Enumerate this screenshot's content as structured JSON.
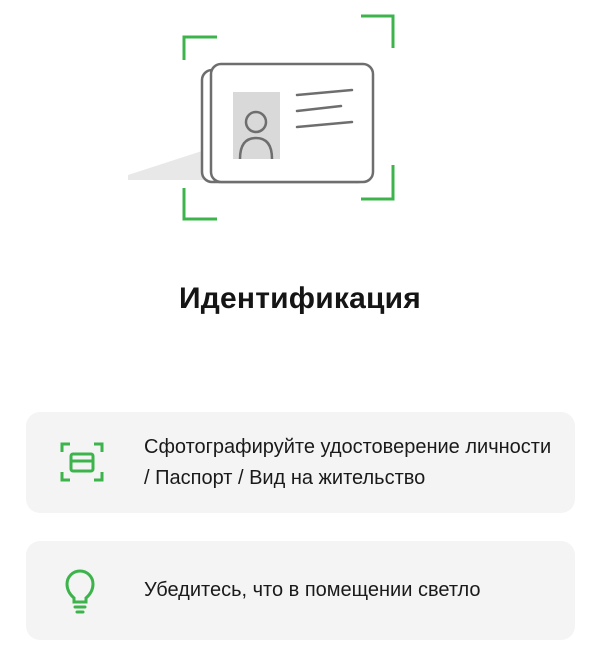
{
  "header": {
    "title": "Идентификация"
  },
  "hero": {
    "icon": "id-card-scan-illustration"
  },
  "steps": [
    {
      "icon": "document-scan-icon",
      "text": "Сфотографируйте удостоверение личности / Паспорт / Вид на жительство"
    },
    {
      "icon": "lightbulb-icon",
      "text": "Убедитесь, что в помещении светло"
    }
  ],
  "colors": {
    "accent": "#3cb44b",
    "card_background": "#f4f4f4",
    "illustration_stroke": "#6e6e6e",
    "photo_placeholder": "#d9d9d9"
  }
}
